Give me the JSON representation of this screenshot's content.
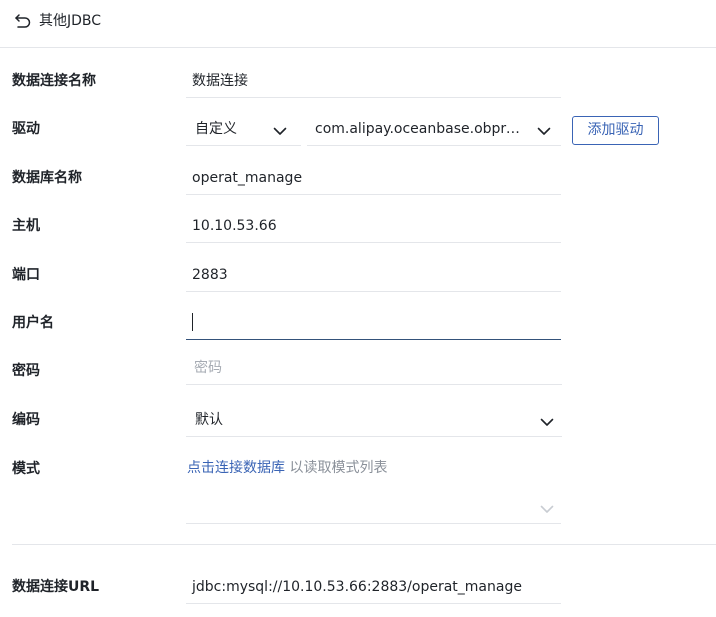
{
  "header": {
    "title": "其他JDBC"
  },
  "form": {
    "connection_name": {
      "label": "数据连接名称",
      "value": "数据连接"
    },
    "driver": {
      "label": "驱动",
      "type_value": "自定义",
      "class_value": "com.alipay.oceanbase.obproxy.mysql.jdbc.Driver",
      "add_button": "添加驱动"
    },
    "database_name": {
      "label": "数据库名称",
      "value": "operat_manage"
    },
    "host": {
      "label": "主机",
      "value": "10.10.53.66"
    },
    "port": {
      "label": "端口",
      "value": "2883"
    },
    "username": {
      "label": "用户名",
      "value": ""
    },
    "password": {
      "label": "密码",
      "placeholder": "密码"
    },
    "encoding": {
      "label": "编码",
      "value": "默认"
    },
    "schema": {
      "label": "模式",
      "link": "点击连接数据库",
      "hint": "以读取模式列表"
    },
    "url": {
      "label": "数据连接URL",
      "value": "jdbc:mysql://10.10.53.66:2883/operat_manage"
    }
  },
  "icons": {
    "back": "back-arrow-icon",
    "dropdown": "chevron-down-icon"
  },
  "colors": {
    "accent": "#3a64b5",
    "border": "#e4e6ea",
    "text": "#1f2329",
    "placeholder": "#a6abb3"
  }
}
